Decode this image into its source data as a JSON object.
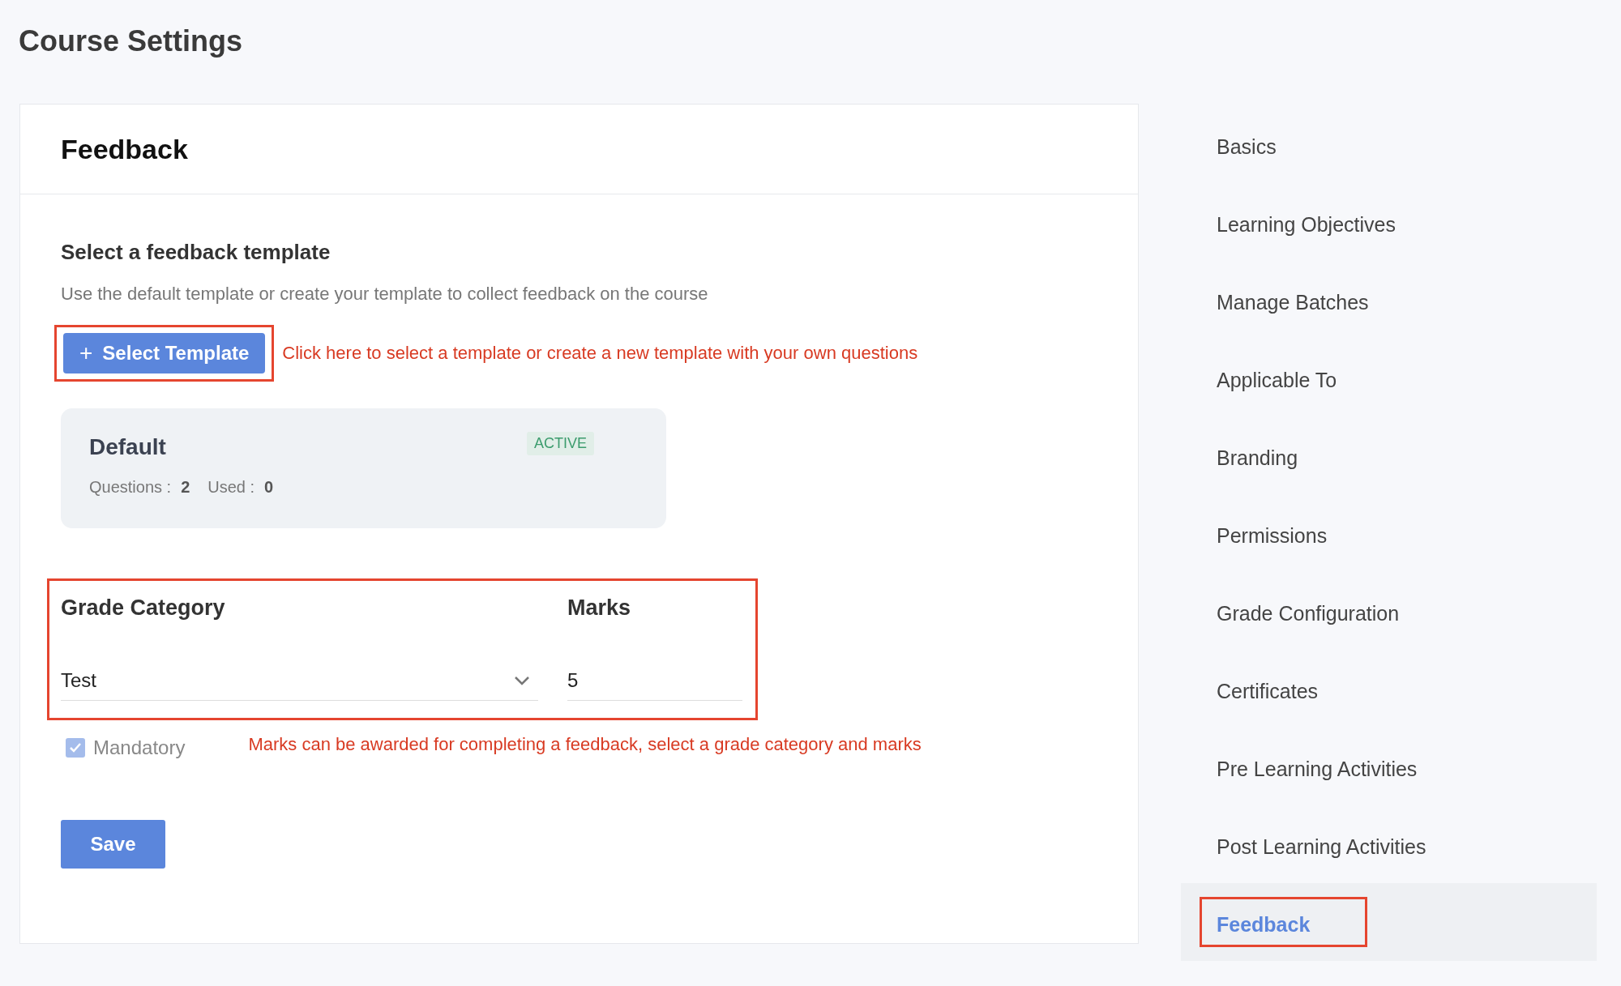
{
  "page": {
    "title": "Course Settings"
  },
  "panel": {
    "title": "Feedback",
    "section_title": "Select a feedback template",
    "description": "Use the default template or create your template to collect feedback on the course",
    "select_button": {
      "label": "+",
      "text": "Select Template"
    },
    "select_hint": "Click here to select a template or create a new template with your own questions",
    "template": {
      "name": "Default",
      "status": "ACTIVE",
      "questions_label": "Questions :",
      "questions": "2",
      "used_label": "Used :",
      "used": "0"
    },
    "grade": {
      "category_label": "Grade Category",
      "category_value": "Test",
      "marks_label": "Marks",
      "marks_value": "5"
    },
    "mandatory": {
      "label": "Mandatory",
      "checked": true,
      "disabled": true
    },
    "marks_hint": "Marks can be awarded for completing a feedback, select a grade category and marks",
    "save_button": {
      "label": "Save"
    }
  },
  "sidebar": {
    "items": [
      {
        "label": "Basics",
        "selected": false
      },
      {
        "label": "Learning Objectives",
        "selected": false
      },
      {
        "label": "Manage Batches",
        "selected": false
      },
      {
        "label": "Applicable To",
        "selected": false
      },
      {
        "label": "Branding",
        "selected": false
      },
      {
        "label": "Permissions",
        "selected": false
      },
      {
        "label": "Grade Configuration",
        "selected": false
      },
      {
        "label": "Certificates",
        "selected": false
      },
      {
        "label": "Pre Learning Activities",
        "selected": false
      },
      {
        "label": "Post Learning Activities",
        "selected": false
      },
      {
        "label": "Feedback",
        "selected": true
      }
    ]
  }
}
